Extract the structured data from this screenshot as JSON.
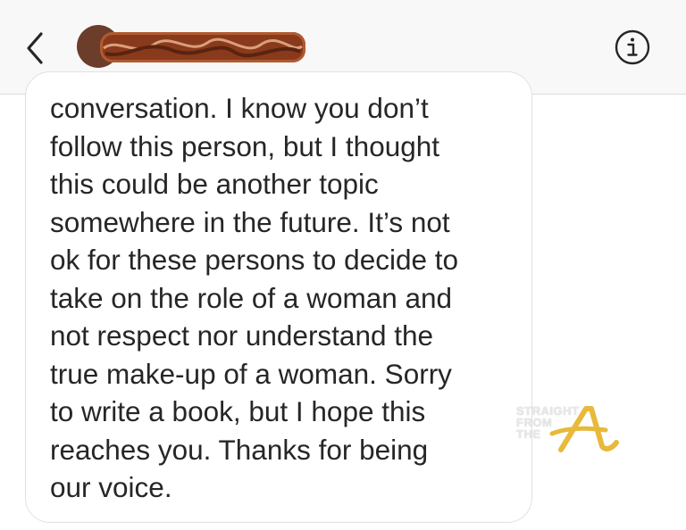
{
  "header": {
    "back_icon": "chevron-left-icon",
    "info_icon": "info-circle-icon",
    "username_redacted": true
  },
  "message": {
    "text": "conversation. I know you don’t\nfollow this person, but I thought\nthis could be another topic\nsomewhere in the future. It’s not\nok for these persons to decide to\ntake on the role of a woman and\nnot respect nor understand the\ntrue make-up of a woman. Sorry\nto write a book, but I hope this\nreaches you. Thanks for being\nour voice."
  },
  "watermark": {
    "line1": "STRAIGHT",
    "line2": "FROM",
    "line3": "THE",
    "letter": "A",
    "color": "#e8b93a"
  }
}
